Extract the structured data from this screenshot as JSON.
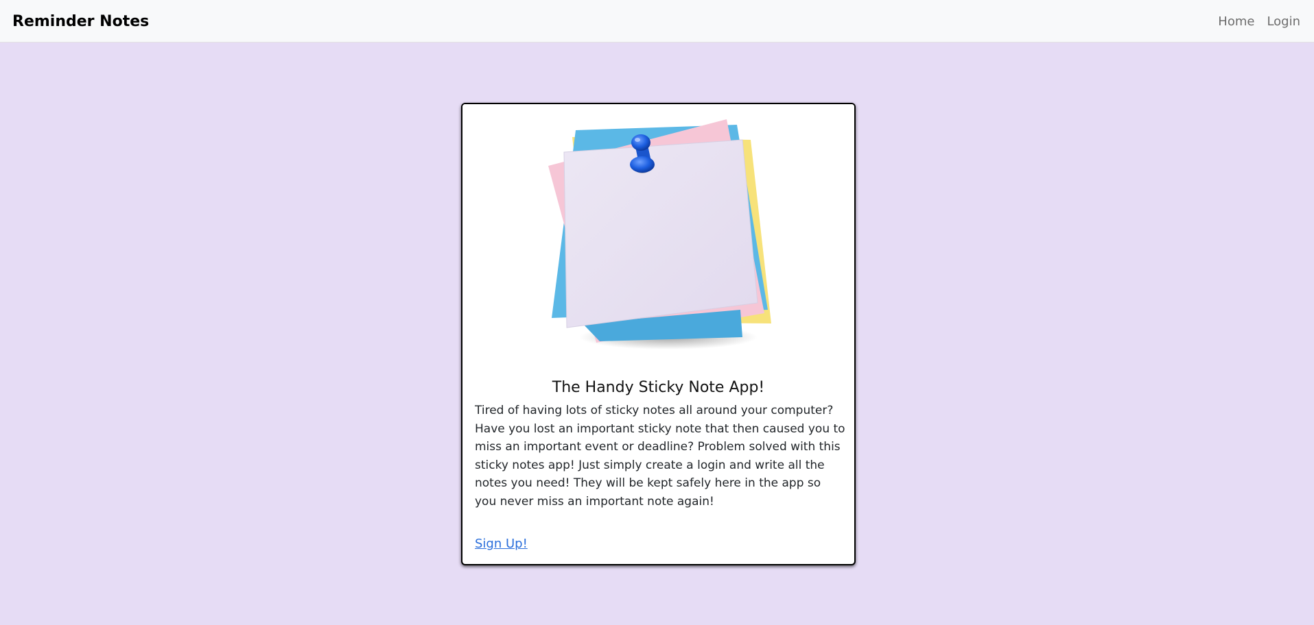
{
  "navbar": {
    "brand": "Reminder Notes",
    "links": [
      {
        "label": "Home"
      },
      {
        "label": "Login"
      }
    ]
  },
  "card": {
    "image_subject": "stack of sticky notes with blue push pin",
    "title": "The Handy Sticky Note App!",
    "text": "Tired of having lots of sticky notes all around your computer? Have you lost an important sticky note that then caused you to miss an important event or deadline? Problem solved with this sticky notes app! Just simply create a login and write all the notes you need! They will be kept safely here in the app so you never miss an important note again!",
    "signup_label": "Sign Up!"
  },
  "colors": {
    "page_background": "#e6dcf5",
    "navbar_background": "#f8f9fa",
    "link": "#2a6edb",
    "note_lilac": "#e9e3f2",
    "note_pink": "#f6c6d6",
    "note_blue": "#5bb8e6",
    "note_yellow": "#f7e27a",
    "pin_blue": "#1d5fe0"
  }
}
